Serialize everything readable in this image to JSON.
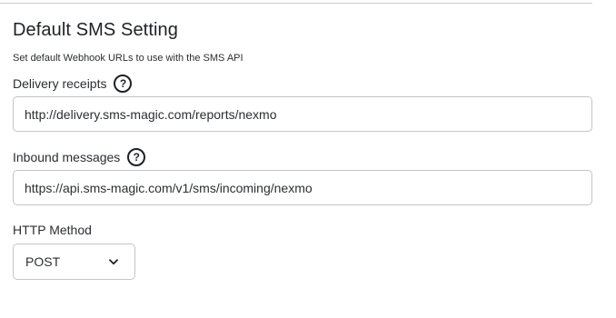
{
  "section": {
    "title": "Default SMS Setting",
    "description": "Set default Webhook URLs to use with the SMS API"
  },
  "delivery": {
    "label": "Delivery receipts",
    "help": "?",
    "value": "http://delivery.sms-magic.com/reports/nexmo"
  },
  "inbound": {
    "label": "Inbound messages",
    "help": "?",
    "value": "https://api.sms-magic.com/v1/sms/incoming/nexmo"
  },
  "http_method": {
    "label": "HTTP Method",
    "selected": "POST"
  },
  "icons": {
    "help": "question-circle-icon",
    "dropdown": "chevron-down-icon"
  }
}
